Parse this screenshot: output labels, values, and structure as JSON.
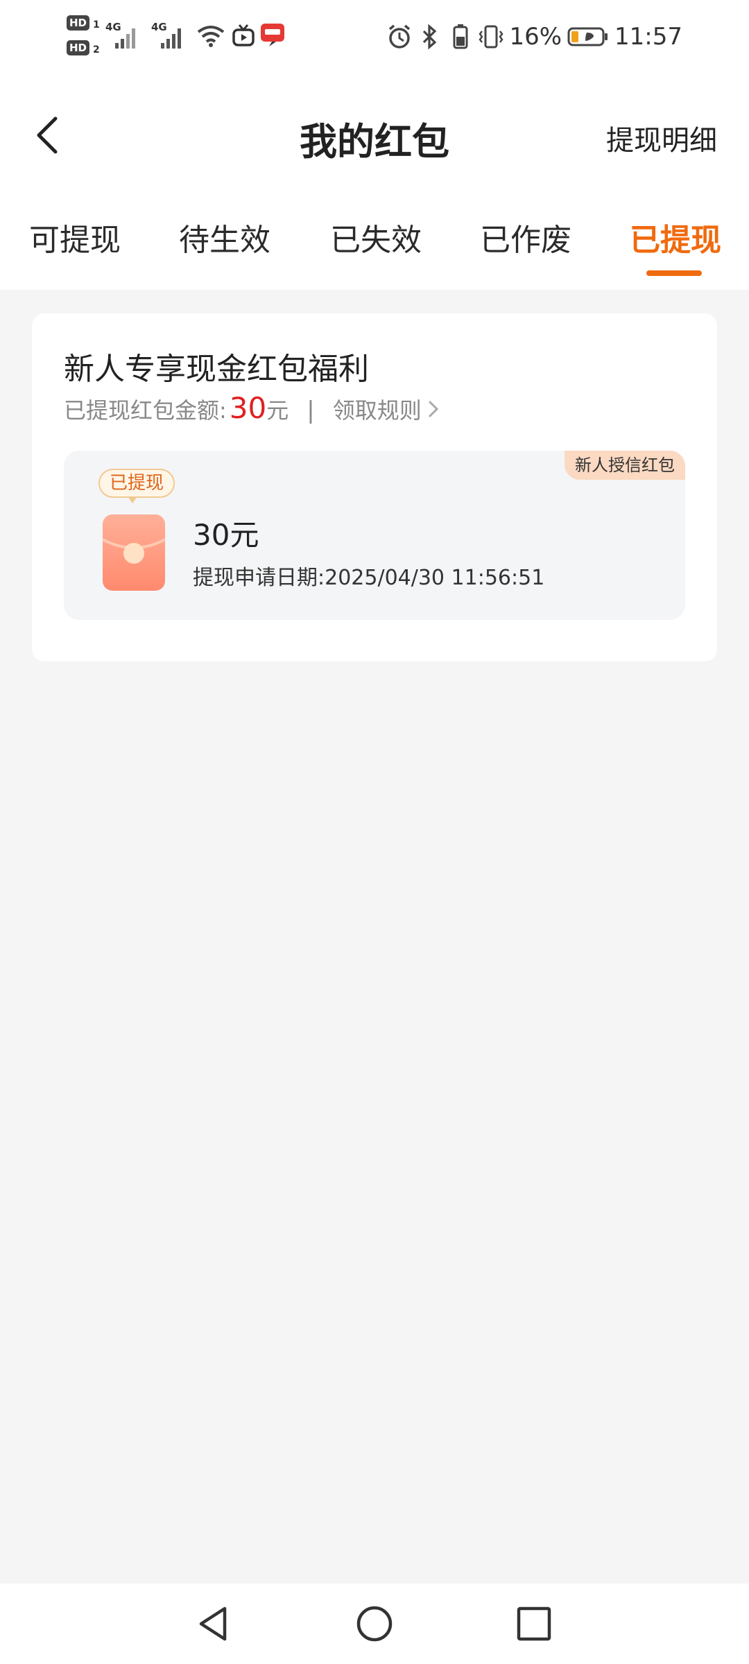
{
  "status_bar": {
    "sim1_label": "HD",
    "sim1_index": "1",
    "sim2_label": "HD",
    "sim2_index": "2",
    "net1": "4G",
    "net2": "4G",
    "battery_percent": "16%",
    "time": "11:57",
    "icons": [
      "signal-icon",
      "wifi-icon",
      "tv-icon",
      "app-notification-icon",
      "alarm-icon",
      "bluetooth-icon",
      "battery-small-icon",
      "vibrate-icon",
      "battery-icon"
    ]
  },
  "header": {
    "back_icon": "chevron-left-icon",
    "title": "我的红包",
    "right_action": "提现明细"
  },
  "tabs": {
    "items": [
      {
        "label": "可提现"
      },
      {
        "label": "待生效"
      },
      {
        "label": "已失效"
      },
      {
        "label": "已作废"
      },
      {
        "label": "已提现"
      }
    ],
    "active_index": 4,
    "active_color": "#f06a0f"
  },
  "card": {
    "title": "新人专享现金红包福利",
    "amount_label": "已提现红包金额:",
    "amount_value": "30",
    "amount_unit": "元",
    "divider": "|",
    "rules_link": "领取规则",
    "amount_color": "#e02020",
    "item": {
      "tag": "新人授信红包",
      "status": "已提现",
      "amount": "30元",
      "date_label": "提现申请日期:",
      "date_value": "2025/04/30 11:56:51",
      "icon": "red-envelope-icon"
    }
  },
  "nav_bar": {
    "icons": [
      "nav-back-icon",
      "nav-home-icon",
      "nav-recent-icon"
    ]
  }
}
